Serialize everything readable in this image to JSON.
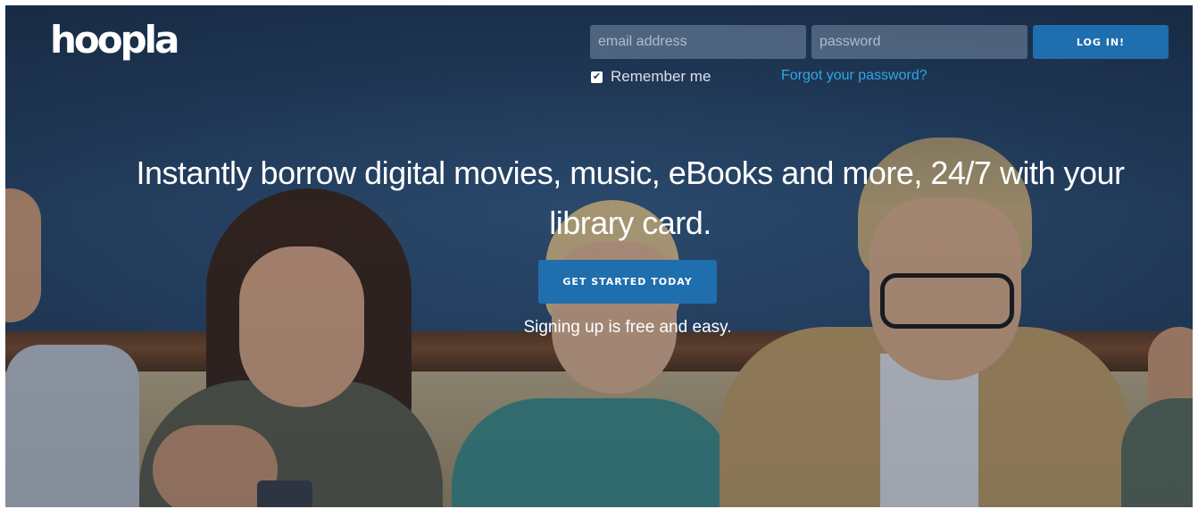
{
  "header": {
    "logo_text": "hoopla",
    "email": {
      "value": "",
      "placeholder": "email address"
    },
    "password": {
      "value": "",
      "placeholder": "password"
    },
    "login_label": "LOG IN!",
    "remember_me": {
      "label": "Remember me",
      "checked": true,
      "check_glyph": "✔"
    },
    "forgot_password": "Forgot your password?"
  },
  "hero": {
    "headline": "Instantly borrow digital movies, music, eBooks and more, 24/7 with your library card.",
    "cta_label": "GET STARTED TODAY",
    "subtext": "Signing up is free and easy."
  },
  "colors": {
    "accent": "#1f6eae",
    "link": "#2fa8e6",
    "hero_overlay": "#1f3553"
  },
  "icons": {
    "remember_checkbox": "checkbox-checked-icon"
  }
}
